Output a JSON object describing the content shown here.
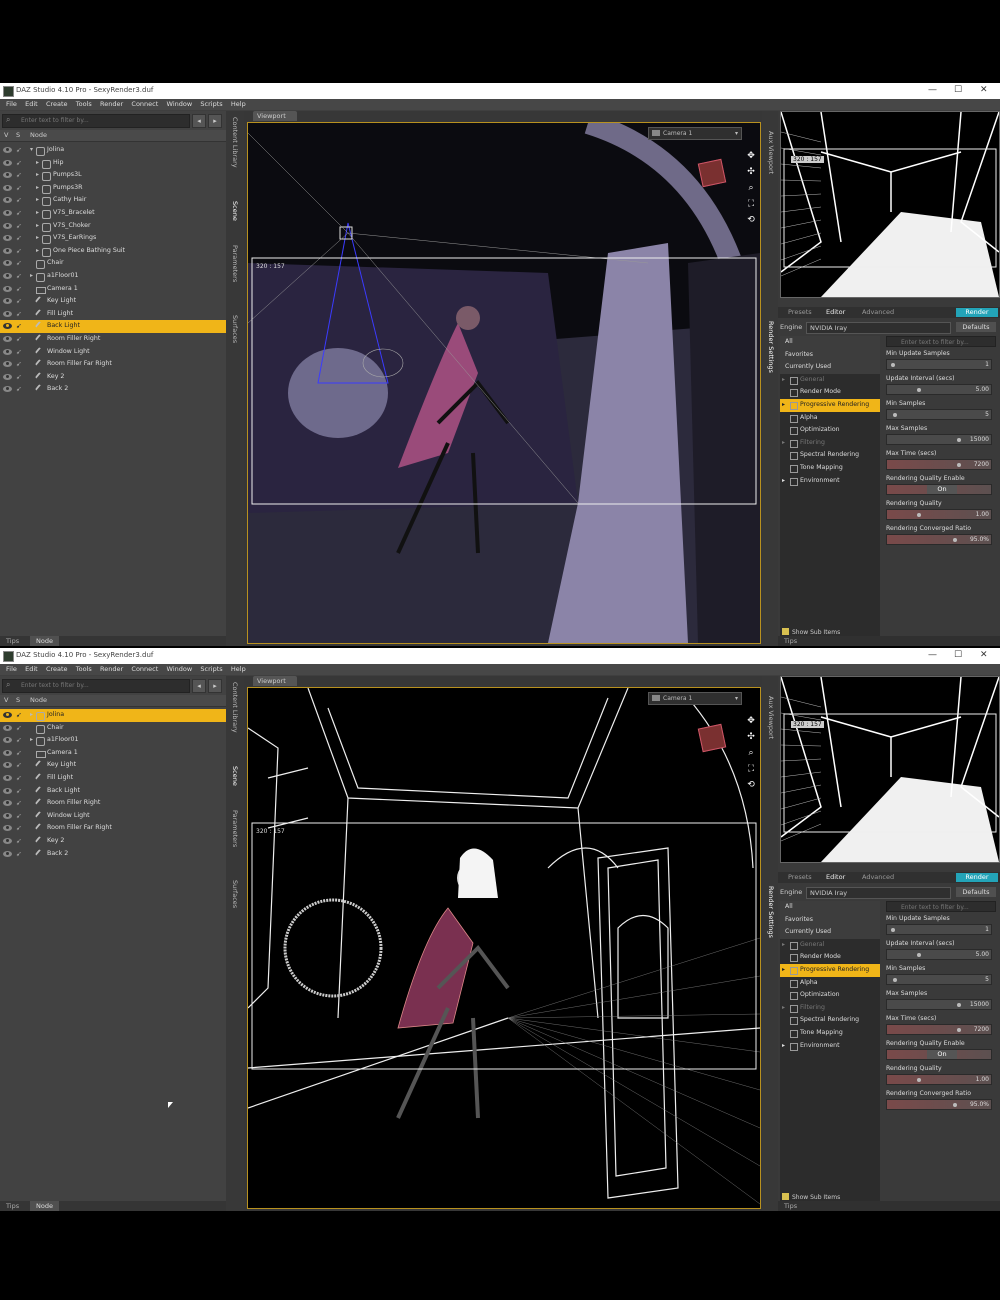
{
  "app": {
    "window_title": "DAZ Studio 4.10 Pro - SexyRender3.duf",
    "menu": [
      "File",
      "Edit",
      "Create",
      "Tools",
      "Render",
      "Connect",
      "Window",
      "Scripts",
      "Help"
    ],
    "window_controls": {
      "minimize": "—",
      "maximize": "☐",
      "close": "✕"
    }
  },
  "scene_pane": {
    "filter_placeholder": "Enter text to filter by...",
    "col_v": "V",
    "col_s": "S",
    "col_node": "Node",
    "bottom_tabs": [
      "Tips",
      "Node"
    ],
    "vertical_tabs": [
      "Content Library",
      "Scene",
      "Parameters",
      "Surfaces"
    ]
  },
  "viewport": {
    "tab_label": "Viewport",
    "camera": "Camera 1",
    "dimensions_label": "320 : 157"
  },
  "right_panel": {
    "vertical_tabs": [
      "Aux Viewport",
      "Render Settings"
    ],
    "aux_dimensions_label": "320 : 157",
    "tabs": [
      "Presets",
      "Editor",
      "Advanced"
    ],
    "render_button": "Render",
    "engine_label": "Engine",
    "engine_value": "NVIDIA Iray",
    "defaults_button": "Defaults",
    "filter_placeholder": "Enter text to filter by...",
    "categories": [
      {
        "label": "All",
        "kind": "hdr"
      },
      {
        "label": "Favorites",
        "kind": "hdr"
      },
      {
        "label": "Currently Used",
        "kind": "hdr"
      },
      {
        "label": "General",
        "kind": "dim",
        "tri": "▸"
      },
      {
        "label": "Render Mode",
        "kind": "sub"
      },
      {
        "label": "Progressive Rendering",
        "kind": "sel",
        "tri": "▸"
      },
      {
        "label": "Alpha",
        "kind": "sub"
      },
      {
        "label": "Optimization",
        "kind": "sub"
      },
      {
        "label": "Filtering",
        "kind": "dim",
        "tri": "▸"
      },
      {
        "label": "Spectral Rendering",
        "kind": "sub"
      },
      {
        "label": "Tone Mapping",
        "kind": "sub"
      },
      {
        "label": "Environment",
        "kind": "sub",
        "tri": "▸"
      }
    ],
    "properties": [
      {
        "name": "Min Update Samples",
        "value": "1",
        "level": 0.03
      },
      {
        "name": "Update Interval (secs)",
        "value": "5.00",
        "level": 0.4
      },
      {
        "name": "Min Samples",
        "value": "5",
        "level": 0.05
      },
      {
        "name": "Max Samples",
        "value": "15000",
        "level": 0.97
      },
      {
        "name": "Max Time (secs)",
        "value": "7200",
        "level": 0.97
      },
      {
        "name": "Rendering Quality Enable",
        "value": "On",
        "toggle": true
      },
      {
        "name": "Rendering Quality",
        "value": "1.00",
        "level": 0.4
      },
      {
        "name": "Rendering Converged Ratio",
        "value": "95.0%",
        "level": 0.92
      }
    ],
    "show_sub_items": "Show Sub Items",
    "tips_tab": "Tips"
  },
  "screen1": {
    "nodes": [
      {
        "label": "Jolina",
        "depth": 0,
        "tw": "▾",
        "icon": "figure-icon"
      },
      {
        "label": "Hip",
        "depth": 1,
        "tw": "▸",
        "icon": "bone-icon"
      },
      {
        "label": "Pumps3L",
        "depth": 1,
        "tw": "▸",
        "icon": "figure-icon"
      },
      {
        "label": "Pumps3R",
        "depth": 1,
        "tw": "▸",
        "icon": "figure-icon"
      },
      {
        "label": "Cathy Hair",
        "depth": 1,
        "tw": "▸",
        "icon": "figure-icon"
      },
      {
        "label": "V7S_Bracelet",
        "depth": 1,
        "tw": "▸",
        "icon": "figure-icon"
      },
      {
        "label": "V7S_Choker",
        "depth": 1,
        "tw": "▸",
        "icon": "figure-icon"
      },
      {
        "label": "V7S_EarRings",
        "depth": 1,
        "tw": "▸",
        "icon": "figure-icon"
      },
      {
        "label": "One Piece Bathing Suit",
        "depth": 1,
        "tw": "▸",
        "icon": "figure-icon"
      },
      {
        "label": "Chair",
        "depth": 0,
        "tw": "",
        "icon": "prop-icon"
      },
      {
        "label": "a1Floor01",
        "depth": 0,
        "tw": "▸",
        "icon": "prop-icon"
      },
      {
        "label": "Camera 1",
        "depth": 0,
        "tw": "",
        "icon": "camera-icon"
      },
      {
        "label": "Key Light",
        "depth": 0,
        "tw": "",
        "icon": "light-icon"
      },
      {
        "label": "Fill Light",
        "depth": 0,
        "tw": "",
        "icon": "light-icon"
      },
      {
        "label": "Back Light",
        "depth": 0,
        "tw": "",
        "icon": "light-icon",
        "selected": true
      },
      {
        "label": "Room Filler Right",
        "depth": 0,
        "tw": "",
        "icon": "light-icon"
      },
      {
        "label": "Window Light",
        "depth": 0,
        "tw": "",
        "icon": "light-icon"
      },
      {
        "label": "Room Filler Far Right",
        "depth": 0,
        "tw": "",
        "icon": "light-icon"
      },
      {
        "label": "Key 2",
        "depth": 0,
        "tw": "",
        "icon": "light-icon"
      },
      {
        "label": "Back 2",
        "depth": 0,
        "tw": "",
        "icon": "light-icon"
      }
    ]
  },
  "screen2": {
    "nodes": [
      {
        "label": "Jolina",
        "depth": 0,
        "tw": "▸",
        "icon": "figure-icon",
        "selected": true
      },
      {
        "label": "Chair",
        "depth": 0,
        "tw": "",
        "icon": "prop-icon"
      },
      {
        "label": "a1Floor01",
        "depth": 0,
        "tw": "▸",
        "icon": "prop-icon"
      },
      {
        "label": "Camera 1",
        "depth": 0,
        "tw": "",
        "icon": "camera-icon"
      },
      {
        "label": "Key Light",
        "depth": 0,
        "tw": "",
        "icon": "light-icon"
      },
      {
        "label": "Fill Light",
        "depth": 0,
        "tw": "",
        "icon": "light-icon"
      },
      {
        "label": "Back Light",
        "depth": 0,
        "tw": "",
        "icon": "light-icon"
      },
      {
        "label": "Room Filler Right",
        "depth": 0,
        "tw": "",
        "icon": "light-icon"
      },
      {
        "label": "Window Light",
        "depth": 0,
        "tw": "",
        "icon": "light-icon"
      },
      {
        "label": "Room Filler Far Right",
        "depth": 0,
        "tw": "",
        "icon": "light-icon"
      },
      {
        "label": "Key 2",
        "depth": 0,
        "tw": "",
        "icon": "light-icon"
      },
      {
        "label": "Back 2",
        "depth": 0,
        "tw": "",
        "icon": "light-icon"
      }
    ]
  },
  "colors": {
    "accent": "#f0b518",
    "render_button": "#23a4b8",
    "viewport_border": "#b8911f"
  }
}
